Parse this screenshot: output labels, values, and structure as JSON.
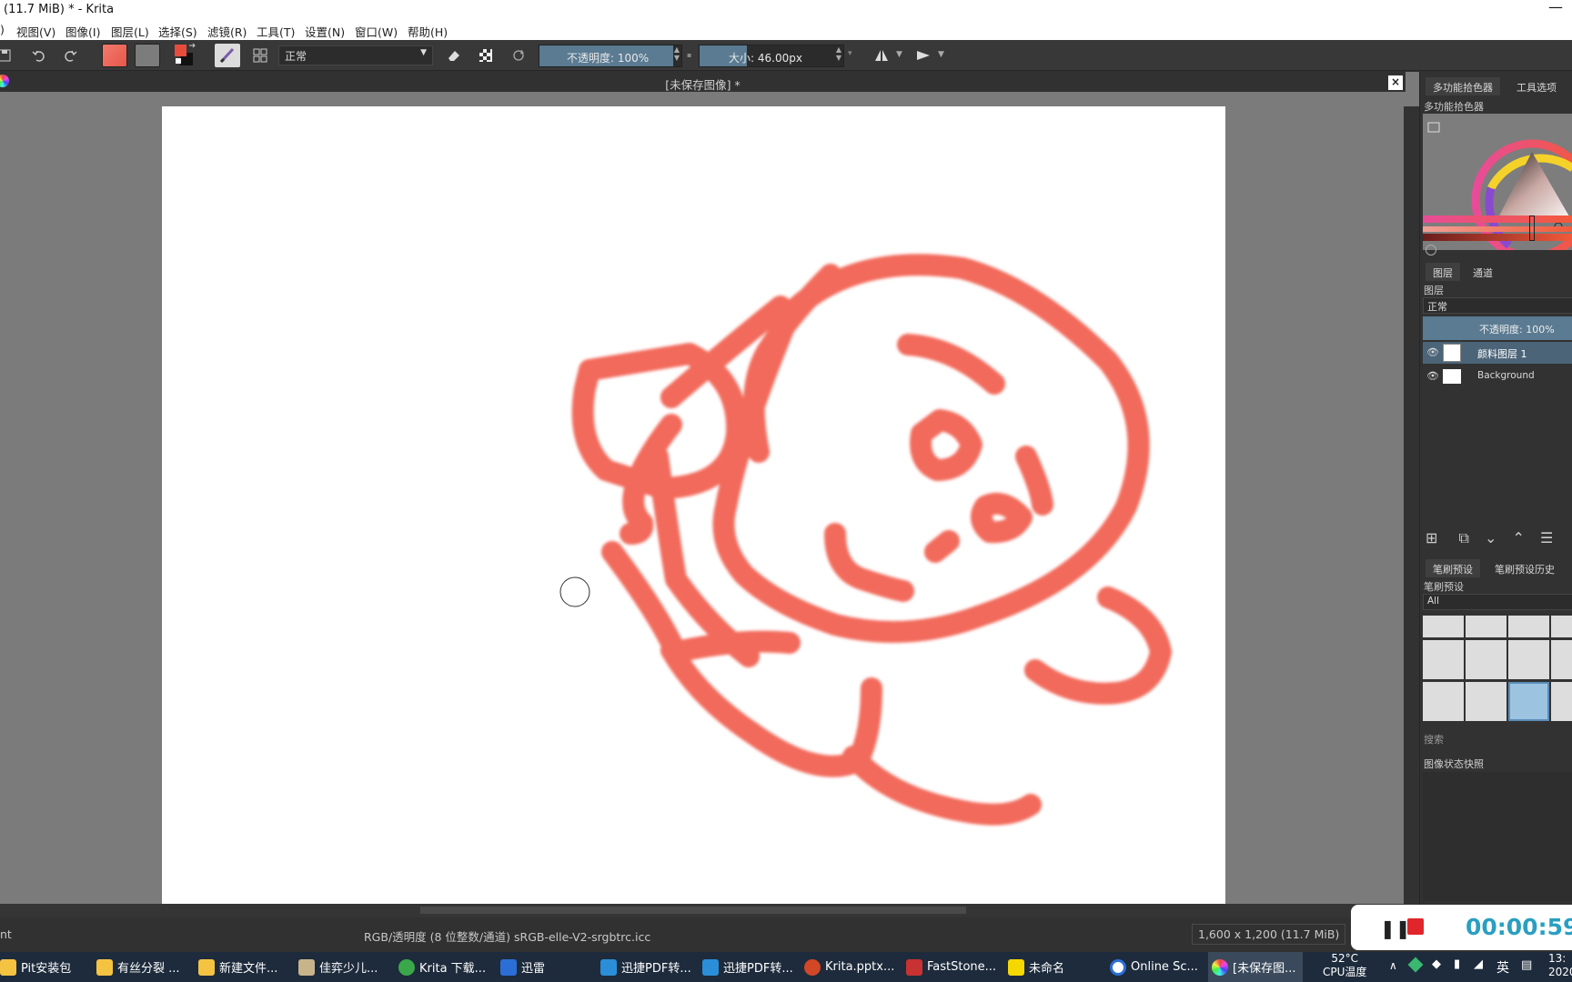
{
  "window": {
    "title": "(11.7 MiB)  * - Krita"
  },
  "menu": [
    "视图(V)",
    "图像(I)",
    "图层(L)",
    "选择(S)",
    "滤镜(R)",
    "工具(T)",
    "设置(N)",
    "窗口(W)",
    "帮助(H)"
  ],
  "toolbar": {
    "blend_mode": "正常",
    "opacity_label": "不透明度: 100%",
    "opacity_value": 100,
    "size_label": "大小: 46.00px"
  },
  "document": {
    "title": "[未保存图像] *"
  },
  "status": {
    "color_model": "RGB/透明度 (8 位整数/通道)  sRGB-elle-V2-srgbtrc.icc",
    "dimensions": "1,600 x 1,200 (11.7 MiB)",
    "left_text": "nt"
  },
  "dock": {
    "top_tabs": [
      "多功能拾色器",
      "工具选项"
    ],
    "color_selector_title": "多功能拾色器",
    "layer_tabs": [
      "图层",
      "通道"
    ],
    "layers_title": "图层",
    "layer_blend": "正常",
    "layer_opacity": "不透明度:  100%",
    "layers": [
      {
        "name": "颜料图层 1"
      },
      {
        "name": "Background"
      }
    ],
    "brush_tabs": [
      "笔刷预设",
      "笔刷预设历史"
    ],
    "brush_title": "笔刷预设",
    "brush_filter": "All",
    "search_label": "搜索",
    "snapshot_title": "图像状态快照"
  },
  "recorder": {
    "time": "00:00:59"
  },
  "taskbar": {
    "items": [
      "Pit安装包",
      "有丝分裂 ...",
      "新建文件...",
      "佳弈少儿...",
      "Krita 下载...",
      "迅雷",
      "迅捷PDF转...",
      "迅捷PDF转...",
      "Krita.pptx...",
      "FastStone...",
      "未命名",
      "Online Sc...",
      "[未保存图..."
    ],
    "temp": "52°C",
    "temp_label": "CPU温度",
    "ime": "英",
    "clock_time": "13:",
    "clock_date": "2020"
  },
  "colors": {
    "stroke": "#f26b5b",
    "accent": "#5a7b92",
    "record": "#e0262c",
    "timer": "#2a9fc0"
  }
}
